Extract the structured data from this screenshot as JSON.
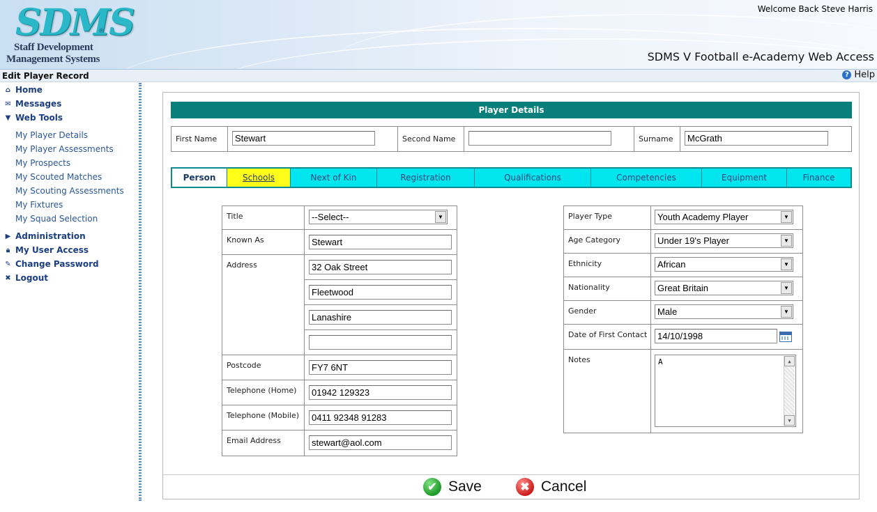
{
  "header": {
    "logo_text": "SDMS",
    "logo_reg": "®",
    "logo_line1": "Staff Development",
    "logo_line2": "Management Systems",
    "welcome": "Welcome Back Steve Harris",
    "app_title": "SDMS V Football e-Academy Web Access"
  },
  "titlebar": {
    "page_title": "Edit Player Record",
    "help": "Help"
  },
  "sidebar": {
    "main_items": [
      {
        "label": "Home",
        "icon": "home-icon"
      },
      {
        "label": "Messages",
        "icon": "messages-icon"
      },
      {
        "label": "Web Tools",
        "icon": "expanded-triangle-icon"
      },
      {
        "label": "Administration",
        "icon": "collapsed-triangle-icon"
      },
      {
        "label": "My User Access",
        "icon": "lock-icon"
      },
      {
        "label": "Change Password",
        "icon": "pen-icon"
      },
      {
        "label": "Logout",
        "icon": "x-icon"
      }
    ],
    "sub_items": [
      "My Player Details",
      "My Player Assessments",
      "My Prospects",
      "My Scouted Matches",
      "My Scouting Assessments",
      "My Fixtures",
      "My Squad Selection"
    ]
  },
  "player_details": {
    "header": "Player Details",
    "first_name_label": "First Name",
    "first_name": "Stewart",
    "second_name_label": "Second Name",
    "second_name": "",
    "surname_label": "Surname",
    "surname": "McGrath"
  },
  "tabs": [
    "Person",
    "Schools",
    "Next of Kin",
    "Registration",
    "Qualifications",
    "Competencies",
    "Equipment",
    "Finance"
  ],
  "left_form": {
    "title_label": "Title",
    "title_value": "--Select--",
    "known_as_label": "Known As",
    "known_as": "Stewart",
    "address_label": "Address",
    "address1": "32 Oak Street",
    "address2": "Fleetwood",
    "address3": "Lanashire",
    "address4": "",
    "postcode_label": "Postcode",
    "postcode": "FY7 6NT",
    "tel_home_label": "Telephone (Home)",
    "tel_home": "01942 129323",
    "tel_mobile_label": "Telephone (Mobile)",
    "tel_mobile": "0411 92348 91283",
    "email_label": "Email Address",
    "email": "stewart@aol.com"
  },
  "right_form": {
    "player_type_label": "Player Type",
    "player_type": "Youth Academy Player",
    "age_category_label": "Age Category",
    "age_category": "Under 19's Player",
    "ethnicity_label": "Ethnicity",
    "ethnicity": "African",
    "nationality_label": "Nationality",
    "nationality": "Great Britain",
    "gender_label": "Gender",
    "gender": "Male",
    "first_contact_label": "Date of First Contact",
    "first_contact": "14/10/1998",
    "notes_label": "Notes",
    "notes": "A"
  },
  "buttons": {
    "save": "Save",
    "cancel": "Cancel"
  }
}
